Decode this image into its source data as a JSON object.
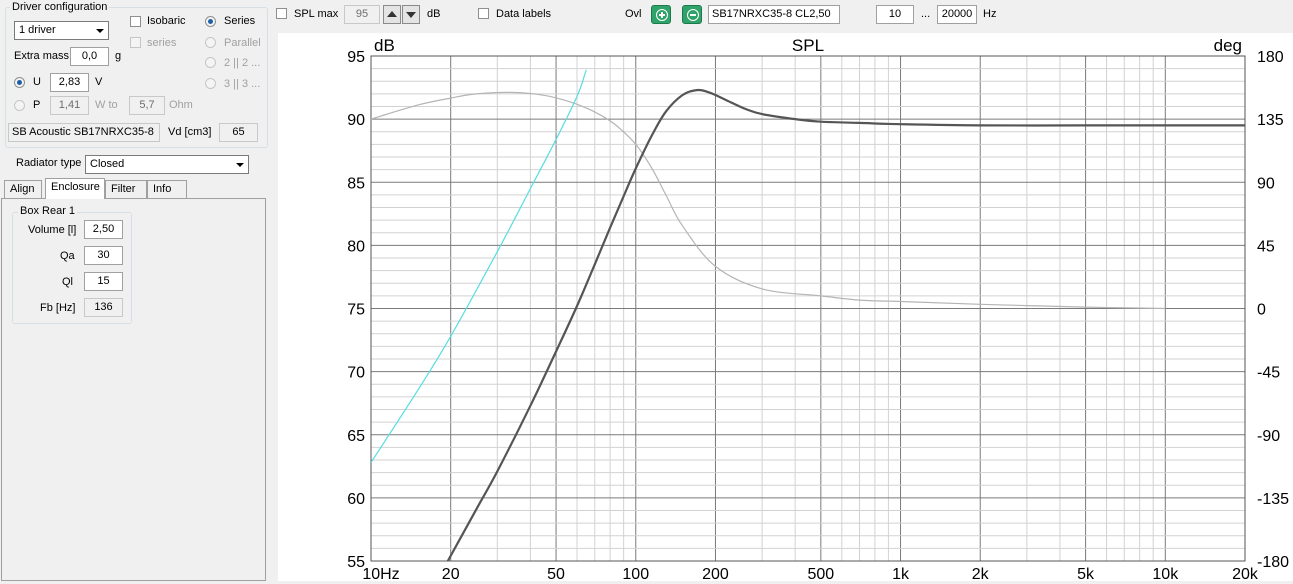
{
  "driver_config": {
    "title": "Driver configuration",
    "drivers_select": "1 driver",
    "isobaric_label": "Isobaric",
    "isobaric_sub_label": "series",
    "series_label": "Series",
    "parallel_label": "Parallel",
    "opt_2_label": "2 || 2 ...",
    "opt_3_label": "3 || 3 ...",
    "extra_mass_label": "Extra mass",
    "extra_mass_value": "0,0",
    "extra_mass_unit": "g",
    "u_label": "U",
    "u_value": "2,83",
    "u_unit": "V",
    "p_label": "P",
    "p_value": "1,41",
    "w_to_label": "W to",
    "ohm_value": "5,7",
    "ohm_unit": "Ohm",
    "driver_name": "SB Acoustic SB17NRXC35-8",
    "vd_label": "Vd [cm3]",
    "vd_value": "65"
  },
  "radiator": {
    "label": "Radiator type",
    "value": "Closed"
  },
  "tabs": [
    "Align",
    "Enclosure",
    "Filter",
    "Info"
  ],
  "active_tab": "Enclosure",
  "enclosure": {
    "group_title": "Box Rear 1",
    "volume_label": "Volume [l]",
    "volume_value": "2,50",
    "qa_label": "Qa",
    "qa_value": "30",
    "ql_label": "Ql",
    "ql_value": "15",
    "fb_label": "Fb [Hz]",
    "fb_value": "136"
  },
  "toolbar": {
    "spl_max_label": "SPL max",
    "spl_max_value": "95",
    "db_label": "dB",
    "data_labels_label": "Data labels",
    "ovl_label": "Ovl",
    "overlay_name": "SB17NRXC35-8 CL2,50",
    "freq_min": "10",
    "freq_sep": "...",
    "freq_max": "20000",
    "hz_label": "Hz"
  },
  "colors": {
    "spl_curve": "#555555",
    "phase_curve": "#b4b4b4",
    "overlay_curve": "#56dde0",
    "add_button": "#2fa36a",
    "remove_button": "#2fa36a"
  },
  "chart_data": {
    "type": "line",
    "title": "SPL",
    "ylabel": "dB",
    "y2label": "deg",
    "xscale": "log",
    "xlim": [
      10,
      20000
    ],
    "ylim": [
      55,
      95
    ],
    "y2lim": [
      -180,
      180
    ],
    "grid": true,
    "xticks": [
      "10Hz",
      "20",
      "50",
      "100",
      "200",
      "500",
      "1k",
      "2k",
      "5k",
      "10k",
      "20k"
    ],
    "xtick_values": [
      10,
      20,
      50,
      100,
      200,
      500,
      1000,
      2000,
      5000,
      10000,
      20000
    ],
    "yticks": [
      95,
      90,
      85,
      80,
      75,
      70,
      65,
      60,
      55
    ],
    "y2ticks": [
      180,
      135,
      90,
      45,
      0,
      -45,
      -90,
      -135,
      -180
    ],
    "series": [
      {
        "axis": "left",
        "x": [
          19.5,
          25,
          30,
          40,
          50,
          60,
          70,
          80,
          90,
          100,
          115,
          130,
          150,
          170,
          190,
          220,
          260,
          300,
          400,
          500,
          700,
          1000,
          2000,
          5000,
          10000,
          20000
        ],
        "values": [
          55,
          59.1,
          62.1,
          67.3,
          71.6,
          75.2,
          78.5,
          81.4,
          83.9,
          86.1,
          88.7,
          90.6,
          91.9,
          92.3,
          92.1,
          91.5,
          90.8,
          90.4,
          90.0,
          89.8,
          89.7,
          89.6,
          89.5,
          89.5,
          89.5,
          89.5
        ]
      },
      {
        "axis": "right",
        "x": [
          10,
          15,
          20,
          25,
          35,
          45,
          55,
          65,
          75,
          85,
          100,
          115,
          130,
          150,
          200,
          300,
          500,
          700,
          1000,
          2000,
          5000,
          10000
        ],
        "values": [
          135,
          145,
          150,
          153,
          154,
          152,
          148,
          143,
          137,
          130,
          117,
          100,
          81,
          59,
          30,
          14,
          9,
          6,
          5,
          3,
          1,
          0
        ]
      },
      {
        "axis": "left",
        "x": [
          10,
          15,
          20,
          30,
          40,
          50,
          60,
          65
        ],
        "values": [
          62.8,
          68.5,
          72.8,
          79.5,
          84.5,
          88.4,
          91.8,
          93.9
        ]
      }
    ]
  }
}
